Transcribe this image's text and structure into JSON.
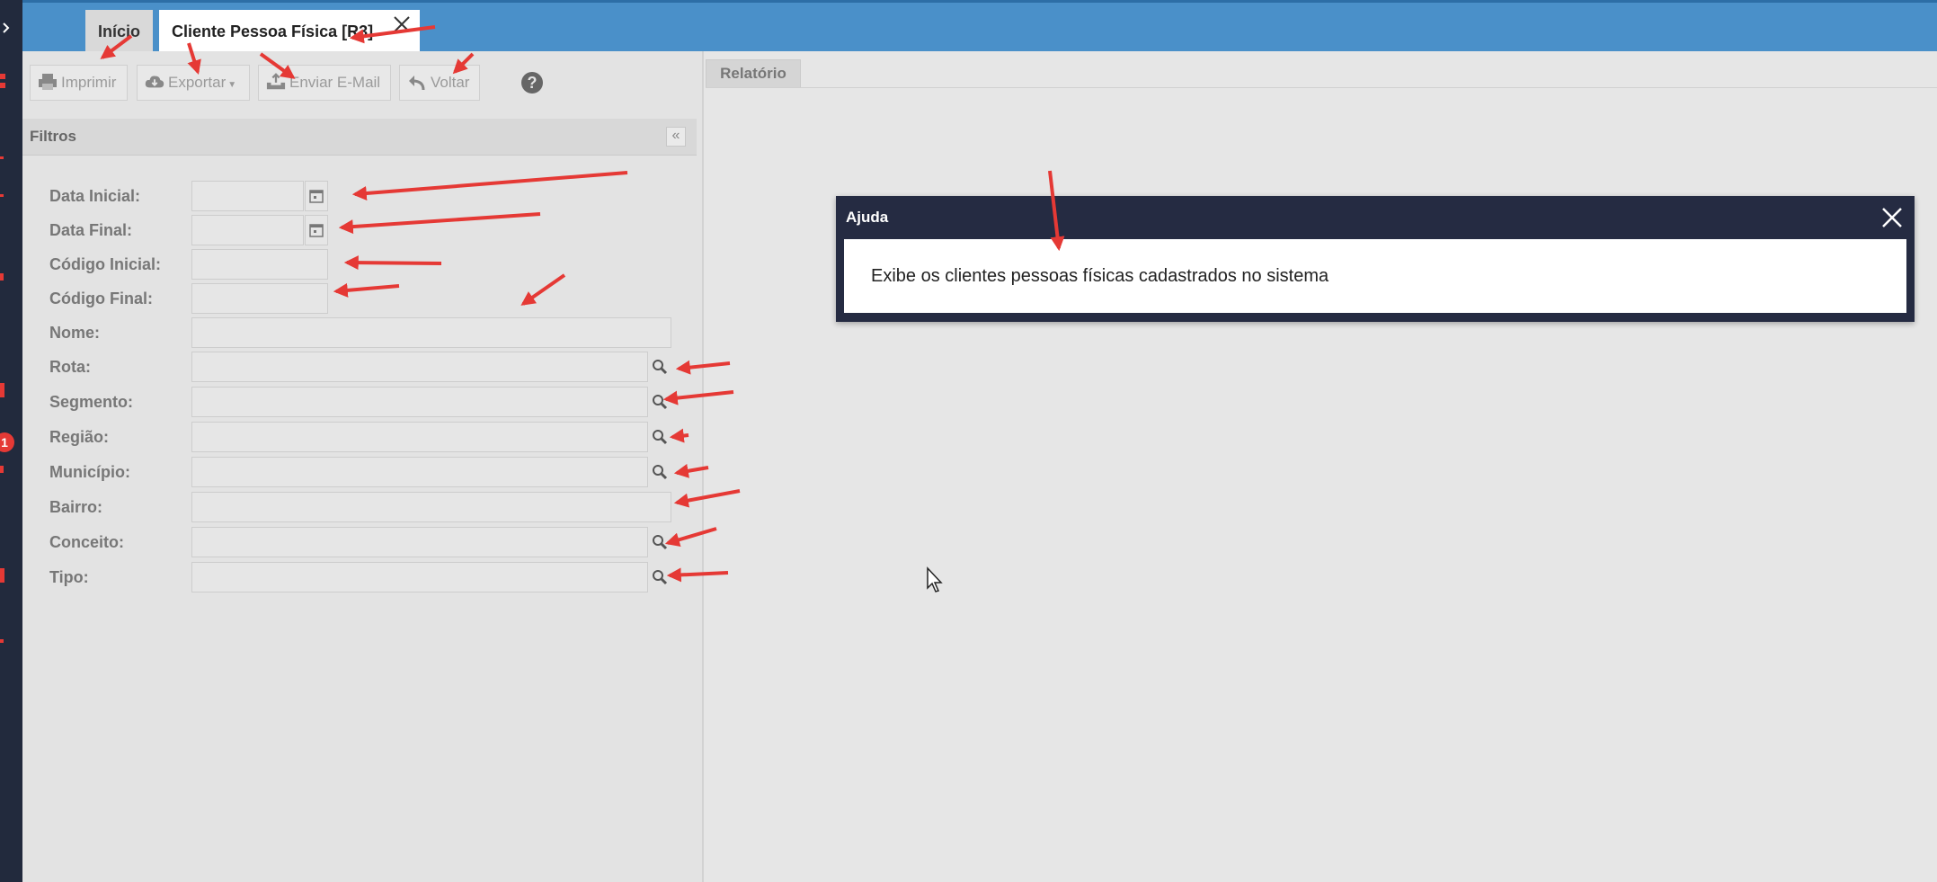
{
  "tabs": [
    {
      "label": "Início"
    },
    {
      "label": "Cliente Pessoa Física [R3]"
    }
  ],
  "toolbar": {
    "imprimir": "Imprimir",
    "exportar": "Exportar",
    "enviar_email": "Enviar E-Mail",
    "voltar": "Voltar",
    "help": "?"
  },
  "filtros": {
    "title": "Filtros",
    "fields": [
      {
        "label": "Data Inicial:",
        "value": ""
      },
      {
        "label": "Data Final:",
        "value": ""
      },
      {
        "label": "Código Inicial:",
        "value": ""
      },
      {
        "label": "Código Final:",
        "value": ""
      },
      {
        "label": "Nome:",
        "value": ""
      },
      {
        "label": "Rota:",
        "value": ""
      },
      {
        "label": "Segmento:",
        "value": ""
      },
      {
        "label": "Região:",
        "value": ""
      },
      {
        "label": "Município:",
        "value": ""
      },
      {
        "label": "Bairro:",
        "value": ""
      },
      {
        "label": "Conceito:",
        "value": ""
      },
      {
        "label": "Tipo:",
        "value": ""
      }
    ]
  },
  "sidebar": {
    "badge": "1"
  },
  "report": {
    "tab_label": "Relatório"
  },
  "help_dialog": {
    "title": "Ajuda",
    "text": "Exibe os clientes pessoas físicas cadastrados no sistema"
  },
  "colors": {
    "topbar": "#4a90c9",
    "sidebar": "#222a3d",
    "dialog": "#252b42",
    "annotation_arrow": "#e53935"
  }
}
